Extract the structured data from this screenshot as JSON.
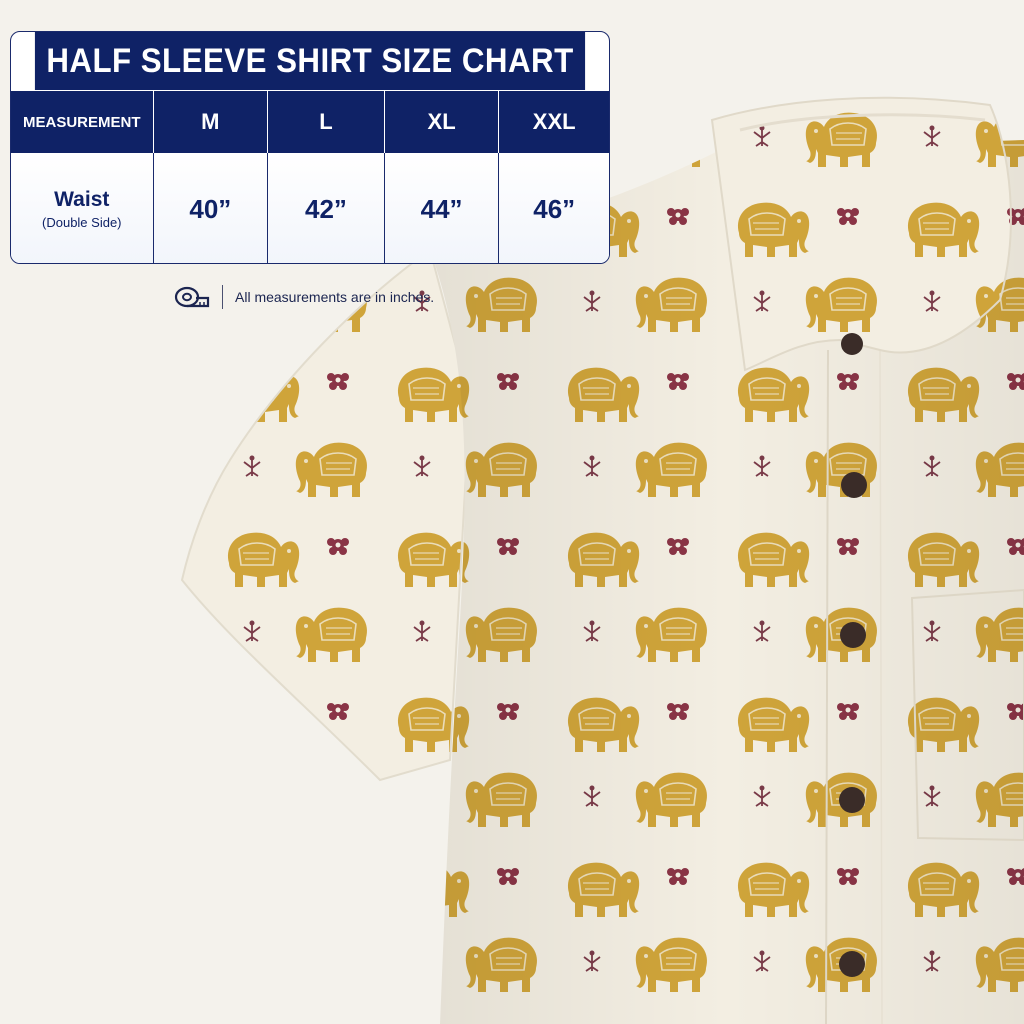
{
  "chart": {
    "title": "HALF SLEEVE SHIRT SIZE CHART",
    "header": {
      "measurement_label": "MEASUREMENT",
      "sizes": [
        "M",
        "L",
        "XL",
        "XXL"
      ]
    },
    "rows": [
      {
        "label": "Waist",
        "sublabel": "(Double Side)",
        "values": [
          "40”",
          "42”",
          "44”",
          "46”"
        ]
      }
    ]
  },
  "note": {
    "icon": "measuring-tape-icon",
    "text": "All measurements are in inches."
  },
  "colors": {
    "navy": "#0f2266",
    "background": "#f4f2ec",
    "fabric": "#f3eee2",
    "elephant_gold": "#cfa43a",
    "flower_maroon": "#8a3446",
    "button_brown": "#3a2c28"
  }
}
